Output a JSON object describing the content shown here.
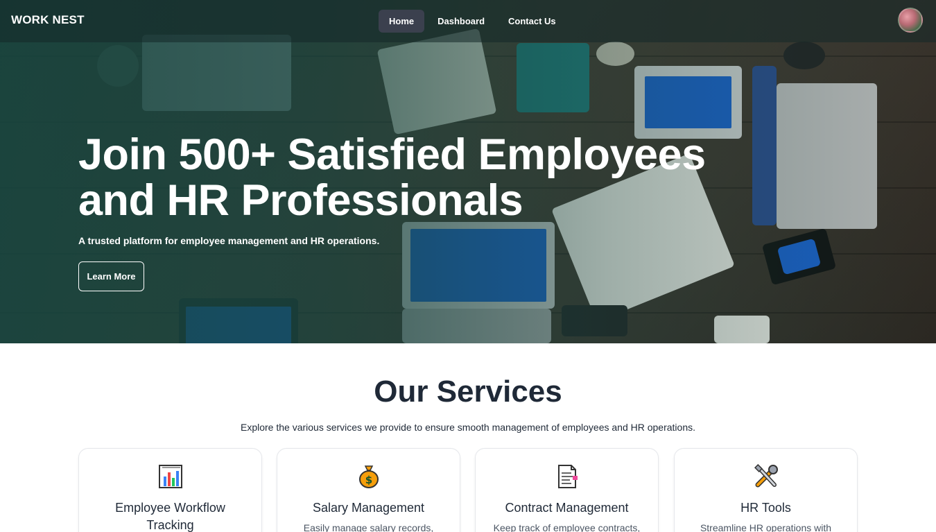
{
  "navbar": {
    "brand": "WORK NEST",
    "links": [
      {
        "label": "Home",
        "active": true
      },
      {
        "label": "Dashboard",
        "active": false
      },
      {
        "label": "Contact Us",
        "active": false
      }
    ]
  },
  "hero": {
    "title": "Join 500+ Satisfied Employees and HR Professionals",
    "subtitle": "A trusted platform for employee management and HR operations.",
    "cta_label": "Learn More",
    "overlay_color": "#164640"
  },
  "services": {
    "title": "Our Services",
    "description": "Explore the various services we provide to ensure smooth management of employees and HR operations.",
    "cards": [
      {
        "icon": "bar-chart-icon",
        "title": "Employee Workflow Tracking",
        "text": ""
      },
      {
        "icon": "money-bag-icon",
        "title": "Salary Management",
        "text": "Easily manage salary records,"
      },
      {
        "icon": "contract-document-icon",
        "title": "Contract Management",
        "text": "Keep track of employee contracts,"
      },
      {
        "icon": "tools-icon",
        "title": "HR Tools",
        "text": "Streamline HR operations with"
      }
    ]
  }
}
